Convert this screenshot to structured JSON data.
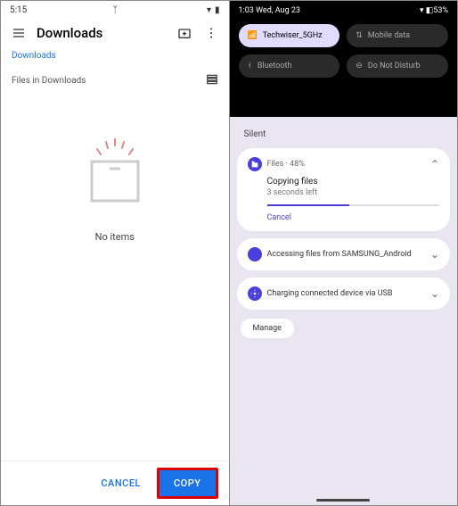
{
  "left": {
    "status_time": "5:15",
    "title": "Downloads",
    "breadcrumb": "Downloads",
    "section": "Files in Downloads",
    "empty_text": "No items",
    "cancel": "CANCEL",
    "copy": "COPY"
  },
  "right": {
    "status_time": "1:03 Wed, Aug 23",
    "battery": "53%",
    "qs": {
      "wifi": "Techwiser_5GHz",
      "mobile": "Mobile data",
      "bt": "Bluetooth",
      "dnd": "Do Not Disturb"
    },
    "silent_label": "Silent",
    "notif1": {
      "app": "Files",
      "percent": "48%",
      "title": "Copying files",
      "sub": "3 seconds left",
      "progress": 48,
      "action": "Cancel"
    },
    "notif2": {
      "text": "Accessing files from SAMSUNG_Android"
    },
    "notif3": {
      "text": "Charging connected device via USB"
    },
    "manage": "Manage"
  }
}
